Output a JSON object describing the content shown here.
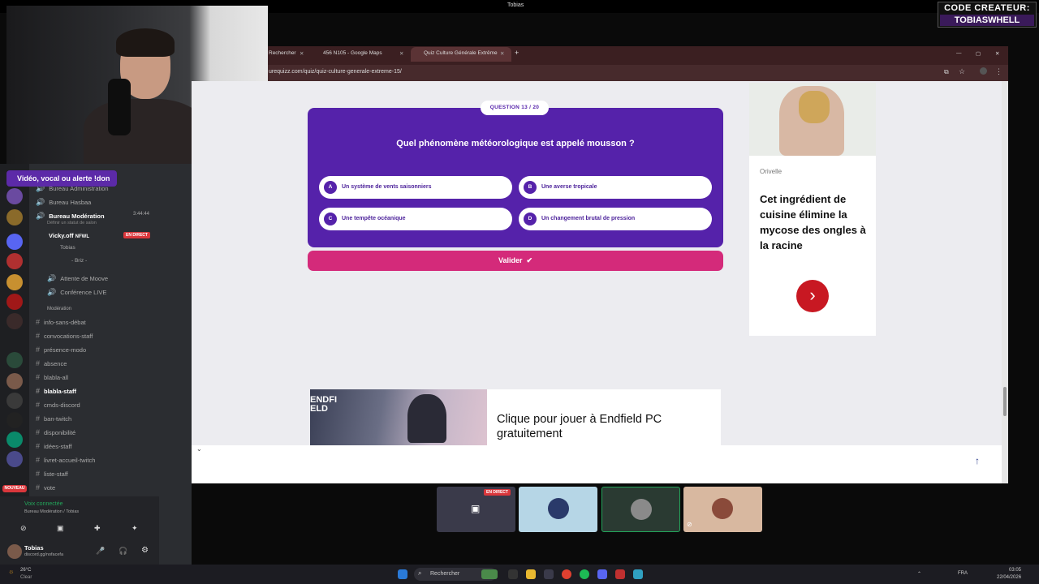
{
  "top": {
    "title": "Tobias",
    "creator_line1": "CODE CREATEUR:",
    "creator_line2": "TOBIASWHELL"
  },
  "discord": {
    "alert": "Vidéo, vocal ou alerte !don",
    "channels": [
      {
        "label": "Bureau Administration"
      },
      {
        "label": "Bureau Hasbaa"
      },
      {
        "label": "Bureau Modération",
        "timer": "3:44:44",
        "sub": "Définir un statut de salon"
      },
      {
        "label": "Vicky.off",
        "tag": "NFWL",
        "badge": "EN DIRECT"
      },
      {
        "label": "Tobias"
      },
      {
        "label": "- Briz -"
      },
      {
        "label": "Attente de Moove"
      },
      {
        "label": "Conférence LIVE"
      },
      {
        "label": "Modération"
      },
      {
        "label": "info-sans-débat"
      },
      {
        "label": "convocations-staff"
      },
      {
        "label": "présence-modo"
      },
      {
        "label": "absence"
      },
      {
        "label": "blabla-all"
      },
      {
        "label": "blabla-staff"
      },
      {
        "label": "cmds-discord"
      },
      {
        "label": "ban-twitch"
      },
      {
        "label": "disponibilité"
      },
      {
        "label": "idées-staff"
      },
      {
        "label": "livret-accueil-twitch"
      },
      {
        "label": "liste-staff"
      },
      {
        "label": "vote"
      }
    ],
    "voice_status": "Voix connectée",
    "voice_channel": "Bureau Modération / Tobias",
    "username": "Tobias",
    "user_sub": "discord.gg/nofacefa",
    "new_badge": "NOUVEAU"
  },
  "browser": {
    "tabs": [
      "Rechercher",
      "456 N105 - Google Maps",
      "Quiz Culture Générale Extrême"
    ],
    "url": "urequizz.com/quiz/quiz-culture-generale-extreme-15/"
  },
  "quiz": {
    "counter": "QUESTION 13 / 20",
    "question": "Quel phénomène météorologique est appelé mousson ?",
    "answers": [
      {
        "letter": "A",
        "text": "Un système de vents saisonniers"
      },
      {
        "letter": "B",
        "text": "Une averse tropicale"
      },
      {
        "letter": "C",
        "text": "Une tempête océanique"
      },
      {
        "letter": "D",
        "text": "Un changement brutal de pression"
      }
    ],
    "submit": "Valider",
    "submit_icon": "✔"
  },
  "ad": {
    "source": "Orivelle",
    "text": "Cet ingrédient de cuisine élimine la mycose des ongles à la racine",
    "arrow": "›"
  },
  "banner": {
    "text": "Clique pour jouer à Endfield PC gratuitement",
    "img_text": "ENDFIELD"
  },
  "call": {
    "live_badge": "EN DIRECT"
  },
  "taskbar": {
    "weather_temp": "26°C",
    "weather_desc": "Clear",
    "search": "Rechercher",
    "lang": "FRA",
    "time": "03:05",
    "date": "22/04/2026"
  },
  "colors": {
    "quiz_bg": "#5522aa",
    "submit": "#d42a7a",
    "ad_button": "#c81822",
    "discord_bg": "#2b2d31"
  }
}
